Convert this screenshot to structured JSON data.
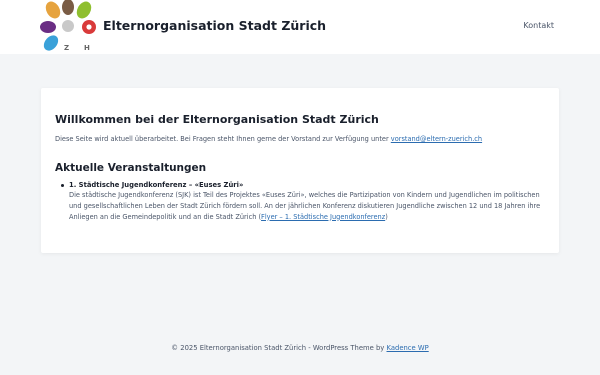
{
  "header": {
    "logo_letters": [
      "Z",
      "H"
    ],
    "site_title": "Elternorganisation Stadt Zürich",
    "nav": {
      "contact_label": "Kontakt"
    }
  },
  "main": {
    "heading": "Willkommen bei der Elternorganisation Stadt Zürich",
    "intro_text": "Diese Seite wird aktuell überarbeitet. Bei Fragen steht Ihnen gerne der Vorstand zur Verfügung unter",
    "intro_email": "vorstand@eltern-zuerich.ch",
    "events_heading": "Aktuelle Veranstaltungen",
    "events": [
      {
        "title": "1. Städtische Jugendkonferenz – «Euses Züri»",
        "description": "Die städtische Jugendkonferenz (SJK) ist Teil des Projektes «Euses Züri», welches die Partizipation von Kindern und Jugendlichen im politischen und gesellschaftlichen Leben der Stadt Zürich fördern soll. An der jährlichen Konferenz diskutieren Jugendliche zwischen 12 und 18 Jahren ihre Anliegen an die Gemeindepolitik und an die Stadt Zürich (",
        "link_label": "Flyer – 1. Städtische Jugendkonferenz",
        "suffix": ")"
      }
    ]
  },
  "footer": {
    "text": "© 2025 Elternorganisation Stadt Zürich - WordPress Theme by",
    "theme_link": "Kadence WP"
  },
  "colors": {
    "page_bg": "#f3f5f7",
    "card_bg": "#ffffff",
    "link": "#2b6cb0",
    "logo_petals": [
      "#e6a33e",
      "#7a5c45",
      "#8fbf2f",
      "#d93a3a",
      "#3aa1d9",
      "#6a2d84"
    ]
  }
}
